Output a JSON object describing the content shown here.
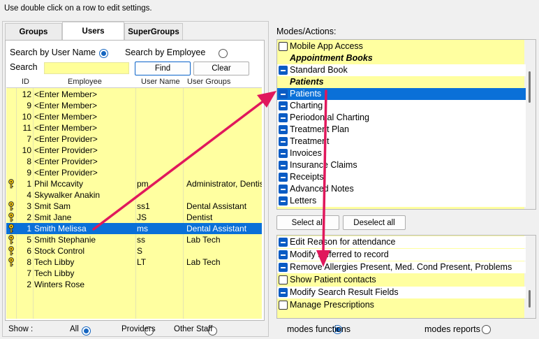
{
  "hint": "Use double click on a row to edit settings.",
  "tabs": [
    {
      "label": "Groups",
      "active": false
    },
    {
      "label": "Users",
      "active": true
    },
    {
      "label": "SuperGroups",
      "active": false
    }
  ],
  "search": {
    "by_user_name": "Search by User Name",
    "by_employee": "Search by Employee",
    "label": "Search",
    "value": "",
    "find": "Find",
    "clear": "Clear"
  },
  "grid": {
    "columns": [
      "ID",
      "Employee",
      "User Name",
      "User Groups"
    ],
    "rows": [
      {
        "key": false,
        "id": "12",
        "employee": "<Enter Member>",
        "user": "",
        "groups": ""
      },
      {
        "key": false,
        "id": "9",
        "employee": "<Enter Member>",
        "user": "",
        "groups": ""
      },
      {
        "key": false,
        "id": "10",
        "employee": "<Enter Member>",
        "user": "",
        "groups": ""
      },
      {
        "key": false,
        "id": "11",
        "employee": "<Enter Member>",
        "user": "",
        "groups": ""
      },
      {
        "key": false,
        "id": "7",
        "employee": "<Enter Provider>",
        "user": "",
        "groups": ""
      },
      {
        "key": false,
        "id": "10",
        "employee": "<Enter Provider>",
        "user": "",
        "groups": ""
      },
      {
        "key": false,
        "id": "8",
        "employee": "<Enter Provider>",
        "user": "",
        "groups": ""
      },
      {
        "key": false,
        "id": "9",
        "employee": "<Enter Provider>",
        "user": "",
        "groups": ""
      },
      {
        "key": true,
        "id": "1",
        "employee": "Phil Mccavity",
        "user": "pm",
        "groups": "Administrator, Dentist"
      },
      {
        "key": false,
        "id": "4",
        "employee": "Skywalker Anakin",
        "user": "",
        "groups": ""
      },
      {
        "key": true,
        "id": "3",
        "employee": "Smit Sam",
        "user": "ss1",
        "groups": "Dental Assistant"
      },
      {
        "key": true,
        "id": "2",
        "employee": "Smit Jane",
        "user": "JS",
        "groups": "Dentist"
      },
      {
        "key": true,
        "id": "1",
        "employee": "Smith Melissa",
        "user": "ms",
        "groups": "Dental Assistant",
        "selected": true
      },
      {
        "key": true,
        "id": "5",
        "employee": "Smith Stephanie",
        "user": "ss",
        "groups": "Lab Tech"
      },
      {
        "key": true,
        "id": "6",
        "employee": "Stock  Control",
        "user": "S",
        "groups": ""
      },
      {
        "key": true,
        "id": "8",
        "employee": "Tech Libby",
        "user": "LT",
        "groups": "Lab Tech"
      },
      {
        "key": false,
        "id": "7",
        "employee": "Tech Libby",
        "user": "",
        "groups": ""
      },
      {
        "key": false,
        "id": "2",
        "employee": "Winters Rose",
        "user": "",
        "groups": ""
      }
    ]
  },
  "show": {
    "label": "Show :",
    "all": "All",
    "providers": "Providers",
    "other_staff": "Other Staff"
  },
  "modes_label": "Modes/Actions:",
  "top_list": [
    {
      "type": "item",
      "checked": false,
      "label": "Mobile App Access",
      "white": false
    },
    {
      "type": "group",
      "label": "Appointment Books"
    },
    {
      "type": "item",
      "checked": true,
      "label": "Standard Book",
      "white": true
    },
    {
      "type": "group",
      "label": "Patients"
    },
    {
      "type": "item",
      "checked": true,
      "label": "Patients",
      "selected": true
    },
    {
      "type": "item",
      "checked": true,
      "label": "Charting",
      "white": true
    },
    {
      "type": "item",
      "checked": true,
      "label": "Periodontal Charting",
      "white": true
    },
    {
      "type": "item",
      "checked": true,
      "label": "Treatment Plan",
      "white": true
    },
    {
      "type": "item",
      "checked": true,
      "label": "Treatment",
      "white": true
    },
    {
      "type": "item",
      "checked": true,
      "label": "Invoices",
      "white": true
    },
    {
      "type": "item",
      "checked": true,
      "label": "Insurance Claims",
      "white": true
    },
    {
      "type": "item",
      "checked": true,
      "label": "Receipts",
      "white": true
    },
    {
      "type": "item",
      "checked": true,
      "label": "Advanced Notes",
      "white": true
    },
    {
      "type": "item",
      "checked": true,
      "label": "Letters",
      "white": true
    }
  ],
  "select_all": "Select all",
  "deselect_all": "Deselect all",
  "bottom_list": [
    {
      "checked": true,
      "label": "Edit Reason for attendance",
      "white": true
    },
    {
      "checked": true,
      "label": "Modify Referred to record",
      "white": true
    },
    {
      "checked": true,
      "label": "Remove Allergies Present, Med. Cond Present, Problems",
      "white": true
    },
    {
      "checked": false,
      "label": "Show Patient contacts",
      "white": false
    },
    {
      "checked": true,
      "label": "Modify Search Result Fields",
      "white": true
    },
    {
      "checked": false,
      "label": "Manage Prescriptions",
      "white": false
    }
  ],
  "modes": {
    "functions": "modes functions",
    "reports": "modes reports"
  },
  "colors": {
    "highlight": "#0a70d8",
    "yellow": "#ffffa0",
    "annotation": "#e0185c"
  }
}
